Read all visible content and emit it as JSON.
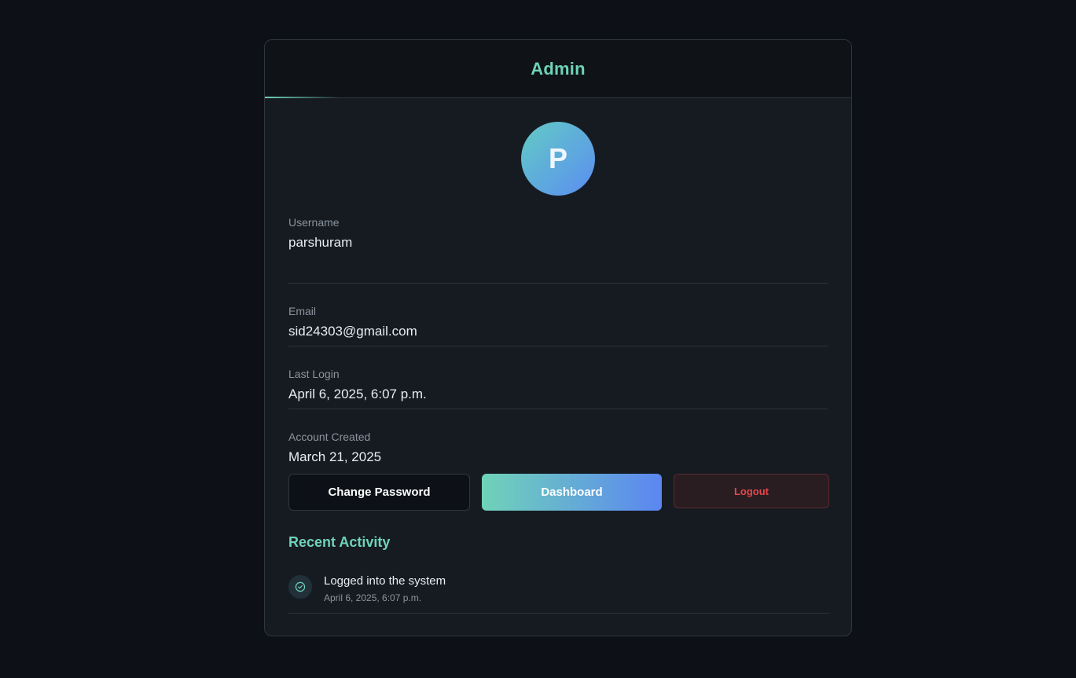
{
  "header": {
    "title": "Admin"
  },
  "profile": {
    "avatar_initial": "P",
    "fields": [
      {
        "label": "Username",
        "value": "parshuram"
      },
      {
        "label": "Email",
        "value": "sid24303@gmail.com"
      },
      {
        "label": "Last Login",
        "value": "April 6, 2025, 6:07 p.m."
      },
      {
        "label": "Account Created",
        "value": "March 21, 2025"
      }
    ]
  },
  "actions": {
    "change_password_label": "Change Password",
    "dashboard_label": "Dashboard",
    "logout_label": "Logout"
  },
  "activity": {
    "title": "Recent Activity",
    "items": [
      {
        "icon": "check-circle-icon",
        "text": "Logged into the system",
        "time": "April 6, 2025, 6:07 p.m."
      }
    ]
  },
  "colors": {
    "background": "#0d1117",
    "card": "#161b22",
    "accent": "#6fd3b8",
    "gradient_end": "#5b86f2",
    "danger": "#e5484d"
  }
}
